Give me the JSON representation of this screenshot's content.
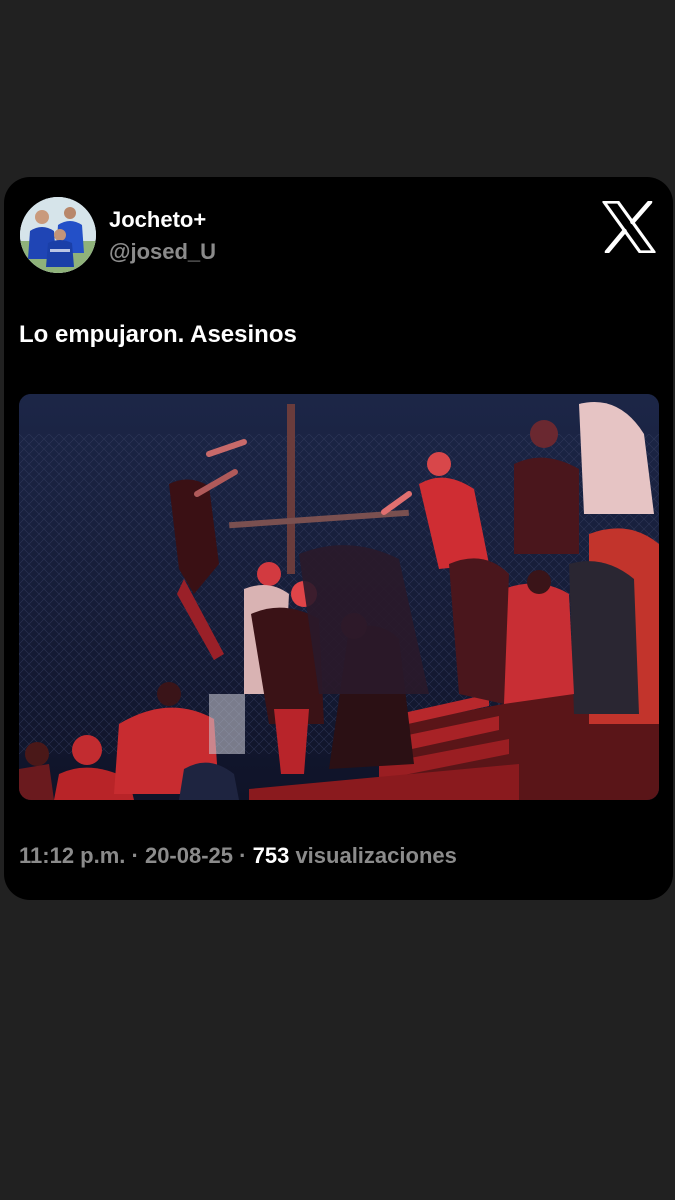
{
  "tweet": {
    "display_name": "Jocheto+",
    "handle": "@josed_U",
    "text": "Lo empujaron. Asesinos",
    "time": "11:12 p.m.",
    "separator": " · ",
    "date": "20-08-25",
    "views_count": "753",
    "views_label": "visualizaciones",
    "logo_icon": "x-logo-icon",
    "media_description_icon": "photo"
  },
  "colors": {
    "page_background": "#212121",
    "card_background": "#000000",
    "primary_text": "#ffffff",
    "secondary_text": "#8b8b8b"
  }
}
